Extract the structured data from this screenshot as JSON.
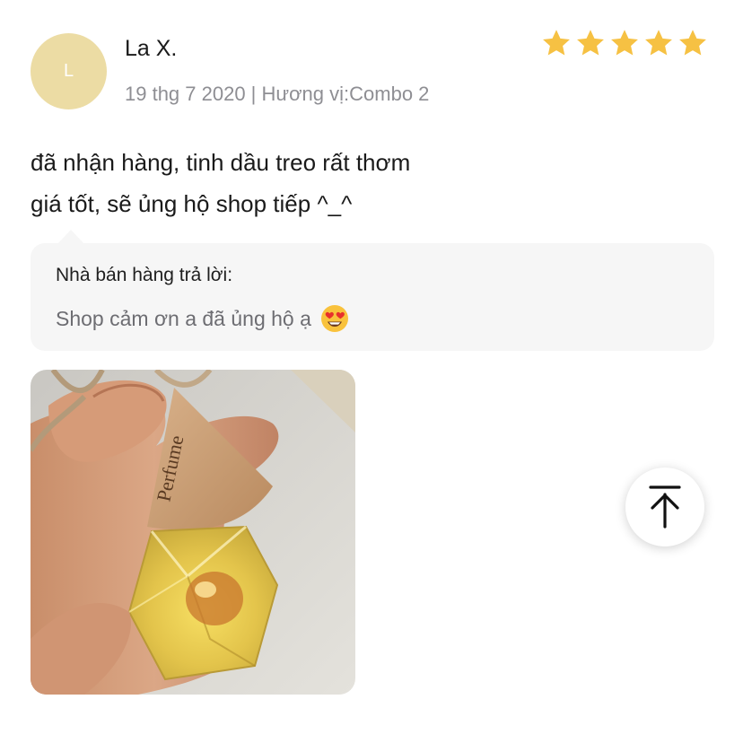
{
  "review": {
    "avatar_initial": "L",
    "reviewer_name": "La X.",
    "meta": "19 thg 7 2020 | Hương vị:Combo 2",
    "rating": 5,
    "rating_color": "#f6c143",
    "body_line1": "đã nhận hàng, tinh dầu treo rất thơm",
    "body_line2": "giá tốt, sẽ ủng hộ shop tiếp ^_^"
  },
  "seller_reply": {
    "title": "Nhà bán hàng trả lời:",
    "text": "Shop cảm ơn a đã ủng hộ ạ",
    "emoji": "heart-eyes-emoji"
  },
  "photo": {
    "label_text": "Perfume"
  },
  "back_to_top": {
    "icon": "arrow-up-to-top-icon"
  }
}
